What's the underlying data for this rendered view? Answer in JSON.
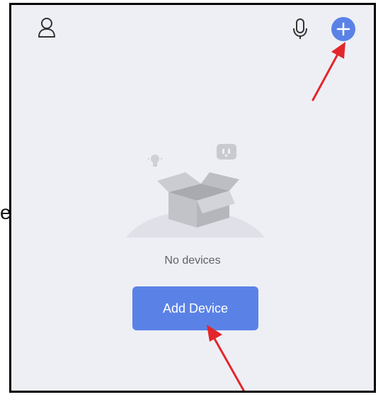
{
  "page": {
    "edge_text": "e"
  },
  "header": {
    "profile_icon": "person-icon",
    "mic_icon": "microphone-icon",
    "add_icon": "plus-icon"
  },
  "empty_state": {
    "message": "No devices",
    "illustration_icon": "empty-box-icon"
  },
  "actions": {
    "add_device_label": "Add Device"
  },
  "colors": {
    "background": "#eeeff5",
    "accent": "#5a82e6",
    "annotation_arrow": "#e3262b",
    "text_muted": "#606266"
  }
}
